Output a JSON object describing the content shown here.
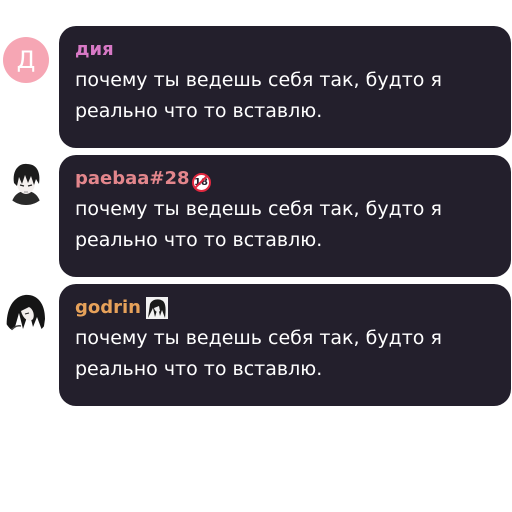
{
  "messages": [
    {
      "avatar_letter": "Д",
      "avatar_icon": "letter-avatar",
      "username": "дия",
      "username_color": "#d879c6",
      "badge": null,
      "text": "почему ты ведешь себя так, будто я\nреально что то вставлю."
    },
    {
      "avatar_icon": "anime-boy-avatar",
      "username": "paebaa#28",
      "username_color": "#e3868c",
      "badge": "18",
      "text": "почему ты ведешь себя так, будто я\nреально что то вставлю."
    },
    {
      "avatar_icon": "anime-girl-avatar",
      "username": "godrin",
      "username_color": "#e6a15a",
      "badge_icon": "manga-sticker-icon",
      "text": "почему ты ведешь себя так, будто я\nреально что то вставлю."
    }
  ]
}
